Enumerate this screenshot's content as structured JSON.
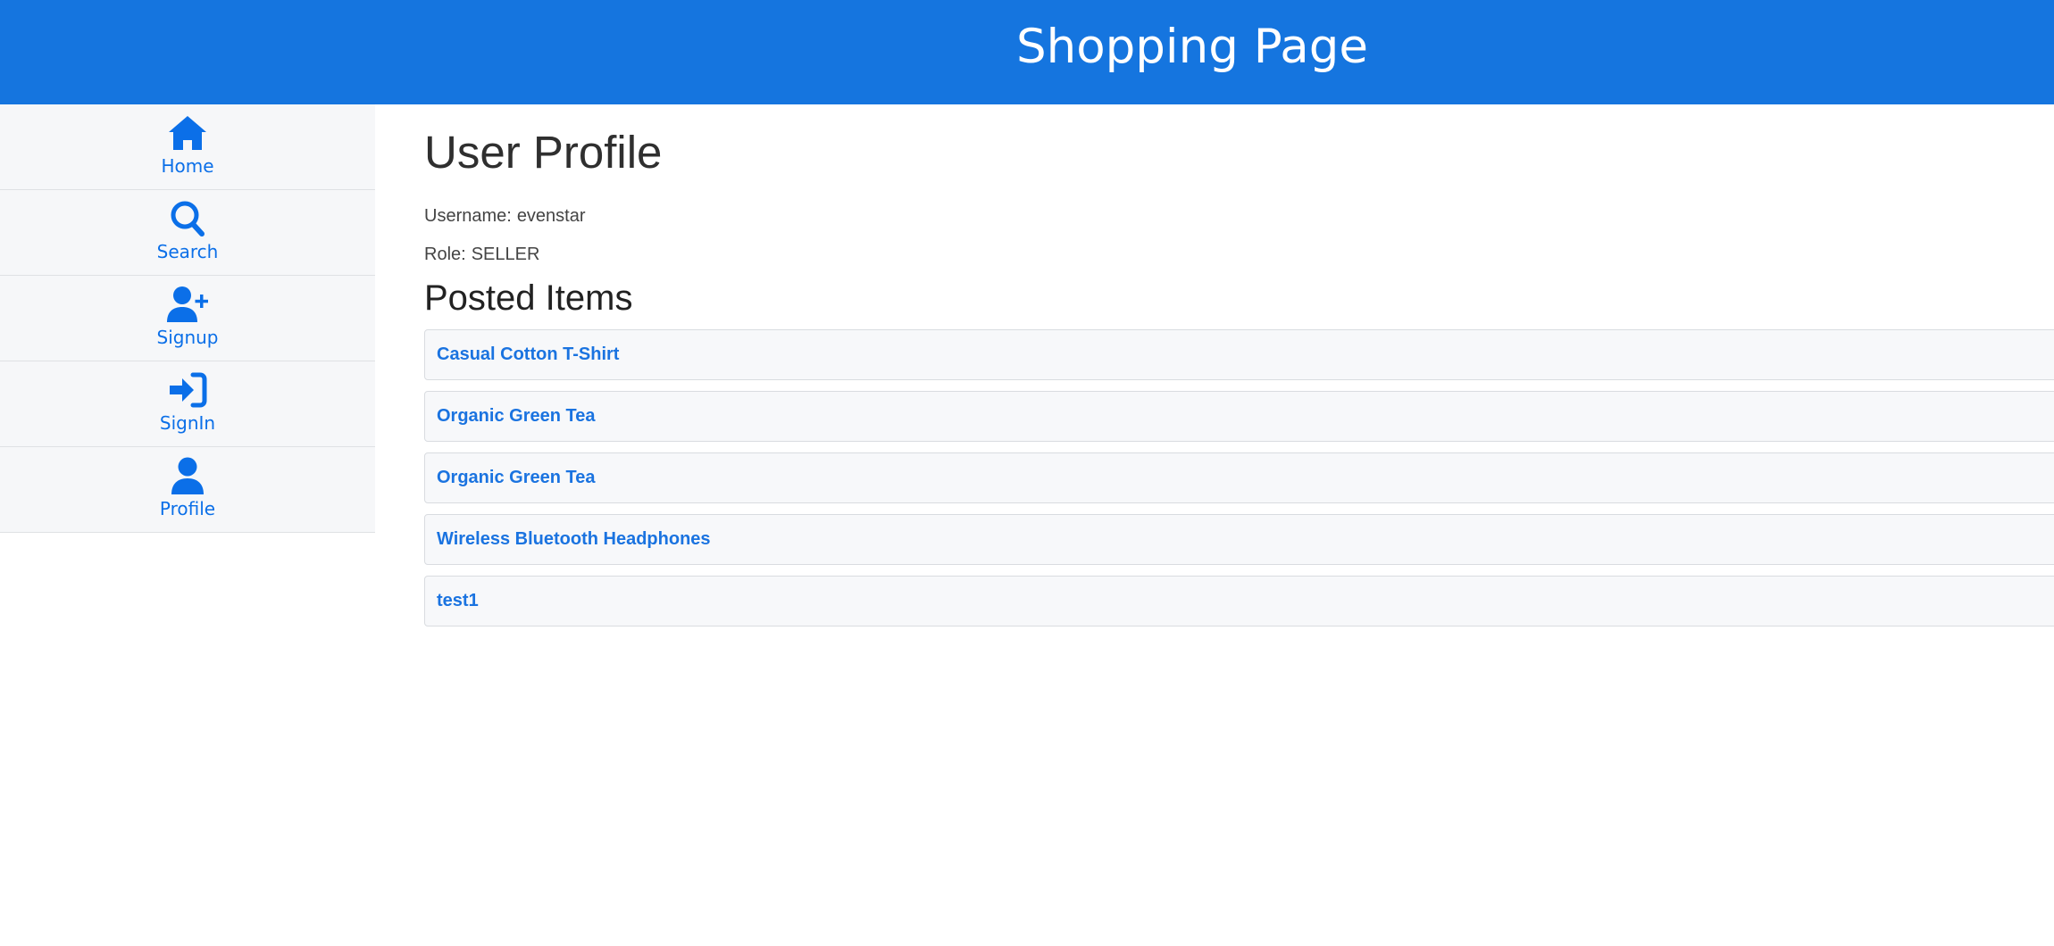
{
  "header": {
    "title": "Shopping Page"
  },
  "sidebar": {
    "items": [
      {
        "label": "Home",
        "icon": "home-icon"
      },
      {
        "label": "Search",
        "icon": "search-icon"
      },
      {
        "label": "Signup",
        "icon": "user-plus-icon"
      },
      {
        "label": "SignIn",
        "icon": "sign-in-icon"
      },
      {
        "label": "Profile",
        "icon": "user-icon"
      }
    ]
  },
  "profile": {
    "title": "User Profile",
    "username_label": "Username:",
    "username": "evenstar",
    "role_label": "Role:",
    "role": "SELLER"
  },
  "posted": {
    "title": "Posted Items",
    "items": [
      {
        "name": "Casual Cotton T-Shirt"
      },
      {
        "name": "Organic Green Tea"
      },
      {
        "name": "Organic Green Tea"
      },
      {
        "name": "Wireless Bluetooth Headphones"
      },
      {
        "name": "test1"
      }
    ]
  },
  "colors": {
    "header_bg": "#1575df",
    "accent": "#0b6fe8",
    "sidebar_bg": "#f6f7f9"
  }
}
